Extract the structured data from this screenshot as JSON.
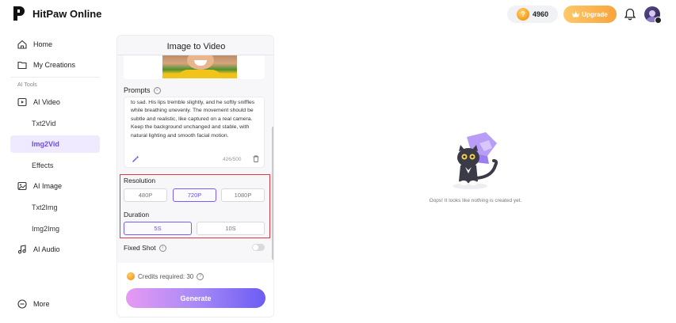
{
  "app": {
    "brand": "HitPaw Online"
  },
  "header": {
    "credits": "4960",
    "upgrade_label": "Upgrade"
  },
  "sidebar": {
    "home": "Home",
    "my_creations": "My Creations",
    "section_label": "AI Tools",
    "ai_video": "AI Video",
    "txt2vid": "Txt2Vid",
    "img2vid": "Img2Vid",
    "effects": "Effects",
    "ai_image": "AI Image",
    "txt2img": "Txt2Img",
    "img2img": "Img2Img",
    "ai_audio": "AI Audio",
    "more": "More"
  },
  "panel": {
    "title": "Image to Video",
    "prompts_label": "Prompts",
    "prompt_text": "to sad. His lips tremble slightly, and he softly sniffles while breathing unevenly. The movement should be subtle and realistic, like captured on a real camera. Keep the background unchanged and stable, with natural lighting and smooth facial motion.",
    "char_count": "426/500",
    "resolution_label": "Resolution",
    "resolutions": [
      "480P",
      "720P",
      "1080P"
    ],
    "selected_resolution": "720P",
    "duration_label": "Duration",
    "durations": [
      "5S",
      "10S"
    ],
    "selected_duration": "5S",
    "fixed_shot_label": "Fixed Shot",
    "fixed_shot_enabled": false,
    "credits_required": "Credits required: 30",
    "generate_label": "Generate"
  },
  "empty_state": {
    "message": "Oops! It looks like nothing is created yet."
  },
  "colors": {
    "accent": "#6c4cf0",
    "highlight": "#e0393e",
    "upgrade": "#f8a43c"
  }
}
